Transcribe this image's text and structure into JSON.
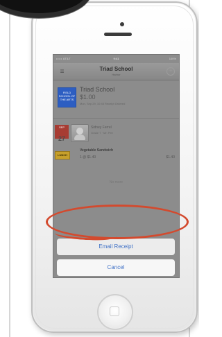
{
  "status_bar": {
    "carrier": "••••• AT&T",
    "time": "9:41",
    "battery": "100%"
  },
  "nav": {
    "title": "Triad School",
    "subtitle": "Harbor",
    "menu_icon": "menu-icon",
    "right_icon": "plus-icon"
  },
  "school": {
    "logo_text": "FIELD SCHOOL OF THE ARTS",
    "name": "Triad School",
    "price": "$1.00",
    "meta": "Mon, Sep 29, 10:45 Receipt Ordered"
  },
  "order": {
    "date_tag": "SEP",
    "date_number": "27",
    "student_name": "Sidney Ferrel",
    "student_meta": "Grade 7 · Mr. Pell",
    "meal_tag": "LUNCH",
    "meal_name": "Vegetable Sandwich",
    "meal_detail": "1 @ $1.40",
    "meal_price": "$1.40"
  },
  "placeholder": "No more",
  "actions": {
    "email_receipt": "Email Receipt",
    "cancel": "Cancel"
  },
  "colors": {
    "highlight": "#d34a2e",
    "action_text": "#3f71c6"
  }
}
